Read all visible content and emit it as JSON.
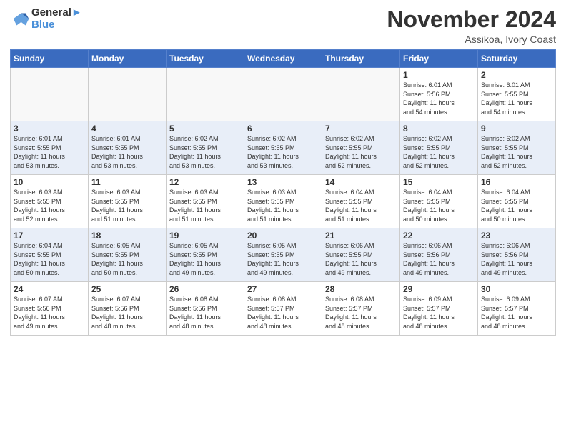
{
  "header": {
    "logo_line1": "General",
    "logo_line2": "Blue",
    "month": "November 2024",
    "location": "Assikoa, Ivory Coast"
  },
  "weekdays": [
    "Sunday",
    "Monday",
    "Tuesday",
    "Wednesday",
    "Thursday",
    "Friday",
    "Saturday"
  ],
  "weeks": [
    [
      {
        "day": "",
        "info": ""
      },
      {
        "day": "",
        "info": ""
      },
      {
        "day": "",
        "info": ""
      },
      {
        "day": "",
        "info": ""
      },
      {
        "day": "",
        "info": ""
      },
      {
        "day": "1",
        "info": "Sunrise: 6:01 AM\nSunset: 5:56 PM\nDaylight: 11 hours\nand 54 minutes."
      },
      {
        "day": "2",
        "info": "Sunrise: 6:01 AM\nSunset: 5:55 PM\nDaylight: 11 hours\nand 54 minutes."
      }
    ],
    [
      {
        "day": "3",
        "info": "Sunrise: 6:01 AM\nSunset: 5:55 PM\nDaylight: 11 hours\nand 53 minutes."
      },
      {
        "day": "4",
        "info": "Sunrise: 6:01 AM\nSunset: 5:55 PM\nDaylight: 11 hours\nand 53 minutes."
      },
      {
        "day": "5",
        "info": "Sunrise: 6:02 AM\nSunset: 5:55 PM\nDaylight: 11 hours\nand 53 minutes."
      },
      {
        "day": "6",
        "info": "Sunrise: 6:02 AM\nSunset: 5:55 PM\nDaylight: 11 hours\nand 53 minutes."
      },
      {
        "day": "7",
        "info": "Sunrise: 6:02 AM\nSunset: 5:55 PM\nDaylight: 11 hours\nand 52 minutes."
      },
      {
        "day": "8",
        "info": "Sunrise: 6:02 AM\nSunset: 5:55 PM\nDaylight: 11 hours\nand 52 minutes."
      },
      {
        "day": "9",
        "info": "Sunrise: 6:02 AM\nSunset: 5:55 PM\nDaylight: 11 hours\nand 52 minutes."
      }
    ],
    [
      {
        "day": "10",
        "info": "Sunrise: 6:03 AM\nSunset: 5:55 PM\nDaylight: 11 hours\nand 52 minutes."
      },
      {
        "day": "11",
        "info": "Sunrise: 6:03 AM\nSunset: 5:55 PM\nDaylight: 11 hours\nand 51 minutes."
      },
      {
        "day": "12",
        "info": "Sunrise: 6:03 AM\nSunset: 5:55 PM\nDaylight: 11 hours\nand 51 minutes."
      },
      {
        "day": "13",
        "info": "Sunrise: 6:03 AM\nSunset: 5:55 PM\nDaylight: 11 hours\nand 51 minutes."
      },
      {
        "day": "14",
        "info": "Sunrise: 6:04 AM\nSunset: 5:55 PM\nDaylight: 11 hours\nand 51 minutes."
      },
      {
        "day": "15",
        "info": "Sunrise: 6:04 AM\nSunset: 5:55 PM\nDaylight: 11 hours\nand 50 minutes."
      },
      {
        "day": "16",
        "info": "Sunrise: 6:04 AM\nSunset: 5:55 PM\nDaylight: 11 hours\nand 50 minutes."
      }
    ],
    [
      {
        "day": "17",
        "info": "Sunrise: 6:04 AM\nSunset: 5:55 PM\nDaylight: 11 hours\nand 50 minutes."
      },
      {
        "day": "18",
        "info": "Sunrise: 6:05 AM\nSunset: 5:55 PM\nDaylight: 11 hours\nand 50 minutes."
      },
      {
        "day": "19",
        "info": "Sunrise: 6:05 AM\nSunset: 5:55 PM\nDaylight: 11 hours\nand 49 minutes."
      },
      {
        "day": "20",
        "info": "Sunrise: 6:05 AM\nSunset: 5:55 PM\nDaylight: 11 hours\nand 49 minutes."
      },
      {
        "day": "21",
        "info": "Sunrise: 6:06 AM\nSunset: 5:55 PM\nDaylight: 11 hours\nand 49 minutes."
      },
      {
        "day": "22",
        "info": "Sunrise: 6:06 AM\nSunset: 5:56 PM\nDaylight: 11 hours\nand 49 minutes."
      },
      {
        "day": "23",
        "info": "Sunrise: 6:06 AM\nSunset: 5:56 PM\nDaylight: 11 hours\nand 49 minutes."
      }
    ],
    [
      {
        "day": "24",
        "info": "Sunrise: 6:07 AM\nSunset: 5:56 PM\nDaylight: 11 hours\nand 49 minutes."
      },
      {
        "day": "25",
        "info": "Sunrise: 6:07 AM\nSunset: 5:56 PM\nDaylight: 11 hours\nand 48 minutes."
      },
      {
        "day": "26",
        "info": "Sunrise: 6:08 AM\nSunset: 5:56 PM\nDaylight: 11 hours\nand 48 minutes."
      },
      {
        "day": "27",
        "info": "Sunrise: 6:08 AM\nSunset: 5:57 PM\nDaylight: 11 hours\nand 48 minutes."
      },
      {
        "day": "28",
        "info": "Sunrise: 6:08 AM\nSunset: 5:57 PM\nDaylight: 11 hours\nand 48 minutes."
      },
      {
        "day": "29",
        "info": "Sunrise: 6:09 AM\nSunset: 5:57 PM\nDaylight: 11 hours\nand 48 minutes."
      },
      {
        "day": "30",
        "info": "Sunrise: 6:09 AM\nSunset: 5:57 PM\nDaylight: 11 hours\nand 48 minutes."
      }
    ]
  ]
}
